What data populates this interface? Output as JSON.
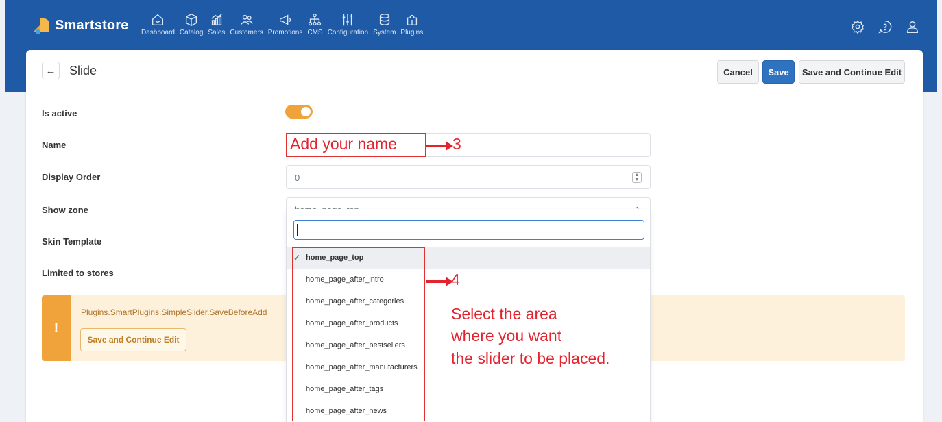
{
  "app": {
    "name": "Smartstore"
  },
  "nav": {
    "items": [
      {
        "label": "Dashboard",
        "icon": "home-icon"
      },
      {
        "label": "Catalog",
        "icon": "box-icon"
      },
      {
        "label": "Sales",
        "icon": "chart-icon"
      },
      {
        "label": "Customers",
        "icon": "users-icon"
      },
      {
        "label": "Promotions",
        "icon": "megaphone-icon"
      },
      {
        "label": "CMS",
        "icon": "sitemap-icon"
      },
      {
        "label": "Configuration",
        "icon": "sliders-icon"
      },
      {
        "label": "System",
        "icon": "database-icon"
      },
      {
        "label": "Plugins",
        "icon": "puzzle-icon"
      }
    ],
    "right_icons": [
      "settings-icon",
      "help-icon",
      "user-icon"
    ]
  },
  "page": {
    "title": "Slide",
    "buttons": {
      "cancel": "Cancel",
      "save": "Save",
      "save_continue": "Save and Continue Edit"
    }
  },
  "form": {
    "is_active": {
      "label": "Is active",
      "value": true
    },
    "name": {
      "label": "Name",
      "value": ""
    },
    "display_order": {
      "label": "Display Order",
      "value": "0"
    },
    "show_zone": {
      "label": "Show zone",
      "value": "home_page_top"
    },
    "skin_template": {
      "label": "Skin Template"
    },
    "limited_to_stores": {
      "label": "Limited to stores"
    }
  },
  "dropdown": {
    "search_value": "",
    "options": [
      "home_page_top",
      "home_page_after_intro",
      "home_page_after_categories",
      "home_page_after_products",
      "home_page_after_bestsellers",
      "home_page_after_manufacturers",
      "home_page_after_tags",
      "home_page_after_news"
    ],
    "selected": "home_page_top"
  },
  "alert": {
    "message": "Plugins.SmartPlugins.SimpleSlider.SaveBeforeAdd",
    "button": "Save and Continue Edit",
    "icon_text": "!"
  },
  "annotations": {
    "name_hint": "Add your name",
    "step3": "3",
    "step4": "4",
    "select_line1": "Select the area",
    "select_line2": "where you want",
    "select_line3": "the slider to be placed."
  },
  "colors": {
    "topbar": "#1f5aa6",
    "primary": "#2f73c0",
    "toggle": "#f1a33b",
    "alert_bg": "#fdf1dc",
    "annotation": "#e3232e"
  }
}
